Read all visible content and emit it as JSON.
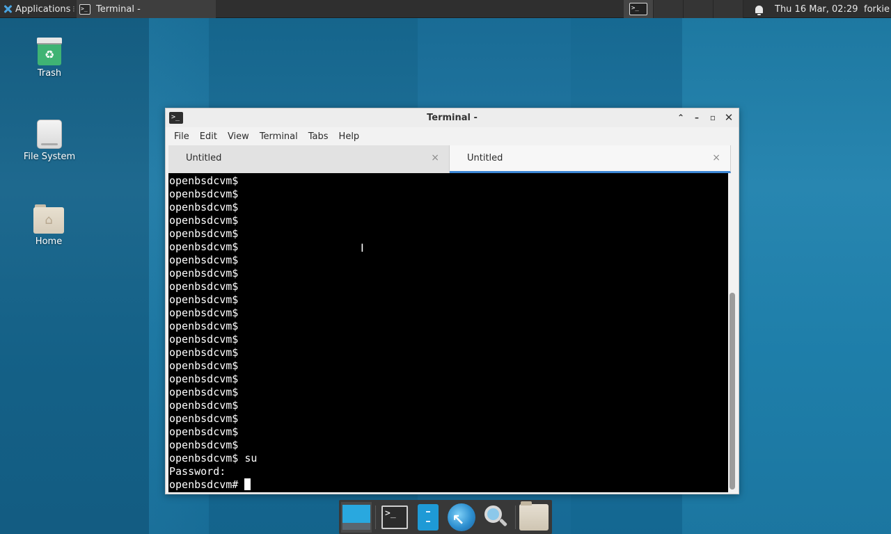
{
  "top_panel": {
    "applications_label": "Applications",
    "applications_sep": "⁝",
    "task_title": "Terminal -",
    "term_glyph": ">_",
    "clock": "Thu 16 Mar, 02:29",
    "user": "forkie"
  },
  "desktop": {
    "icons": [
      {
        "label": "Trash",
        "icon": "trash-icon"
      },
      {
        "label": "File System",
        "icon": "drive-icon"
      },
      {
        "label": "Home",
        "icon": "home-folder-icon"
      }
    ]
  },
  "terminal": {
    "title": "Terminal -",
    "icon_glyph": ">_",
    "controls": {
      "shade": "⌃",
      "minimize": "–",
      "maximize": "▫",
      "close": "✕"
    },
    "menu": [
      "File",
      "Edit",
      "View",
      "Terminal",
      "Tabs",
      "Help"
    ],
    "tabs": [
      {
        "label": "Untitled",
        "close": "×",
        "active": false
      },
      {
        "label": "Untitled",
        "close": "×",
        "active": true
      }
    ],
    "lines": [
      "openbsdcvm$",
      "openbsdcvm$",
      "openbsdcvm$",
      "openbsdcvm$",
      "openbsdcvm$",
      "openbsdcvm$",
      "openbsdcvm$",
      "openbsdcvm$",
      "openbsdcvm$",
      "openbsdcvm$",
      "openbsdcvm$",
      "openbsdcvm$",
      "openbsdcvm$",
      "openbsdcvm$",
      "openbsdcvm$",
      "openbsdcvm$",
      "openbsdcvm$",
      "openbsdcvm$",
      "openbsdcvm$",
      "openbsdcvm$",
      "openbsdcvm$",
      "openbsdcvm$ su",
      "Password:"
    ],
    "prompt_line": "openbsdcvm# "
  },
  "dock": {
    "items": [
      "show-desktop",
      "terminal",
      "file-manager",
      "web-browser",
      "app-finder",
      "home-folder"
    ],
    "terminal_glyph": ">_"
  },
  "colors": {
    "accent": "#3b86d4",
    "terminal_bg": "#000000",
    "terminal_fg": "#ffffff",
    "panel_bg": "#2f2f2f"
  }
}
